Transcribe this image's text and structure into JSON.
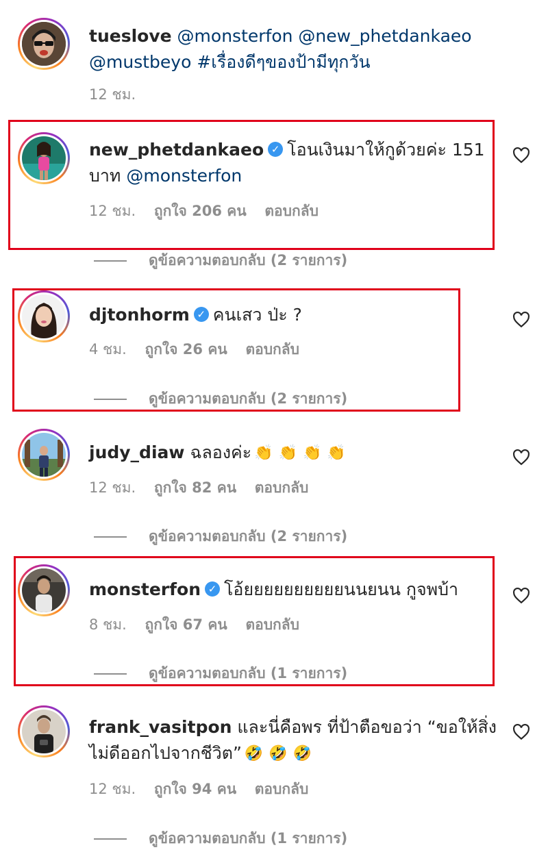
{
  "colors": {
    "highlight": "#e0001a",
    "verified": "#3897f0",
    "mention": "#00376b",
    "meta": "#8e8e8e"
  },
  "comments": [
    {
      "username": "tueslove",
      "verified": false,
      "body_parts": [
        "@monsterfon",
        "@new_phetdankaeo",
        "@mustbeyo",
        "#เรื่องดีๆของป้ามีทุกวัน"
      ],
      "time": "12 ชม.",
      "likes": "",
      "reply_label": "",
      "view_replies": ""
    },
    {
      "username": "new_phetdankaeo",
      "verified": true,
      "body_text": "โอนเงินมาให้กูด้วยค่ะ 151 บาท",
      "body_mention": "@monsterfon",
      "time": "12 ชม.",
      "likes": "ถูกใจ 206 คน",
      "reply_label": "ตอบกลับ",
      "view_replies": "ดูข้อความตอบกลับ (2 รายการ)",
      "icon": "heart-icon"
    },
    {
      "username": "djtonhorm",
      "verified": true,
      "body_text": "คนเสว ป่ะ ?",
      "time": "4 ชม.",
      "likes": "ถูกใจ 26 คน",
      "reply_label": "ตอบกลับ",
      "view_replies": "ดูข้อความตอบกลับ (2 รายการ)",
      "icon": "heart-icon"
    },
    {
      "username": "judy_diaw",
      "verified": false,
      "body_text": "ฉลองค่ะ",
      "emoji": [
        "👏",
        "👏",
        "👏",
        "👏"
      ],
      "time": "12 ชม.",
      "likes": "ถูกใจ 82 คน",
      "reply_label": "ตอบกลับ",
      "view_replies": "ดูข้อความตอบกลับ (2 รายการ)",
      "icon": "heart-icon"
    },
    {
      "username": "monsterfon",
      "verified": true,
      "body_text": "โอ้ยยยยยยยยยยนนยนน กูจพบ้า",
      "time": "8 ชม.",
      "likes": "ถูกใจ 67 คน",
      "reply_label": "ตอบกลับ",
      "view_replies": "ดูข้อความตอบกลับ (1 รายการ)",
      "icon": "heart-icon"
    },
    {
      "username": "frank_vasitpon",
      "verified": false,
      "body_text": "และนี่คือพร ที่ป้าตือขอว่า “ขอให้สิ่งไม่ดีออกไปจากชีวิต”",
      "emoji": [
        "🤣",
        "🤣",
        "🤣"
      ],
      "time": "12 ชม.",
      "likes": "ถูกใจ 94 คน",
      "reply_label": "ตอบกลับ",
      "view_replies": "ดูข้อความตอบกลับ (1 รายการ)",
      "icon": "heart-icon"
    }
  ]
}
